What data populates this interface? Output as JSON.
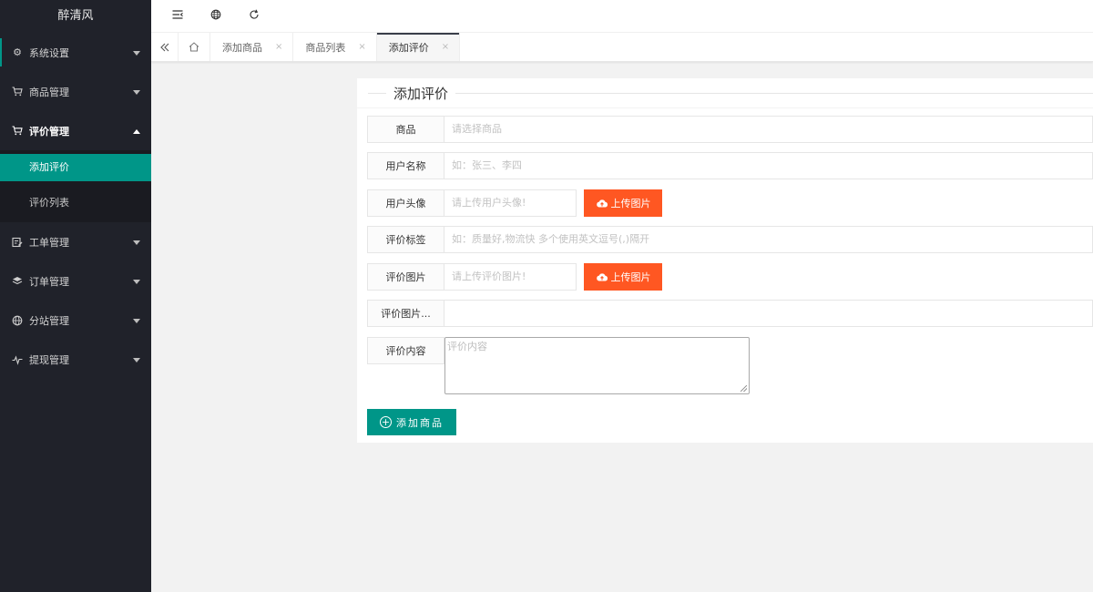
{
  "sidebar": {
    "logo": "醉清风",
    "items": [
      {
        "label": "系统设置",
        "icon": "gear-icon"
      },
      {
        "label": "商品管理",
        "icon": "cart-icon"
      },
      {
        "label": "评价管理",
        "icon": "cart-icon"
      },
      {
        "label": "工单管理",
        "icon": "ticket-icon"
      },
      {
        "label": "订单管理",
        "icon": "layers-icon"
      },
      {
        "label": "分站管理",
        "icon": "globe-icon"
      },
      {
        "label": "提现管理",
        "icon": "pulse-icon"
      }
    ],
    "subitems": [
      {
        "label": "添加评价"
      },
      {
        "label": "评价列表"
      }
    ]
  },
  "header": {
    "icons": [
      "menu-shrink-icon",
      "globe-icon",
      "refresh-icon"
    ]
  },
  "tabs": {
    "items": [
      {
        "label": "添加商品",
        "close": "×"
      },
      {
        "label": "商品列表",
        "close": "×"
      },
      {
        "label": "添加评价",
        "close": "×"
      }
    ]
  },
  "form": {
    "title": "添加评价",
    "fields": {
      "product": {
        "label": "商品",
        "placeholder": "请选择商品"
      },
      "username": {
        "label": "用户名称",
        "placeholder": "如：张三、李四"
      },
      "avatar": {
        "label": "用户头像",
        "placeholder": "请上传用户头像!",
        "button": "上传图片"
      },
      "tags": {
        "label": "评价标签",
        "placeholder": "如：质量好,物流快 多个使用英文逗号(,)隔开"
      },
      "images": {
        "label": "评价图片",
        "placeholder": "请上传评价图片!",
        "button": "上传图片"
      },
      "images_preview": {
        "label": "评价图片..."
      },
      "content": {
        "label": "评价内容",
        "placeholder": "评价内容"
      }
    },
    "submit": "添加商品"
  },
  "colors": {
    "sidebar_bg": "#20222a",
    "accent": "#009688",
    "upload": "#ff5722"
  }
}
